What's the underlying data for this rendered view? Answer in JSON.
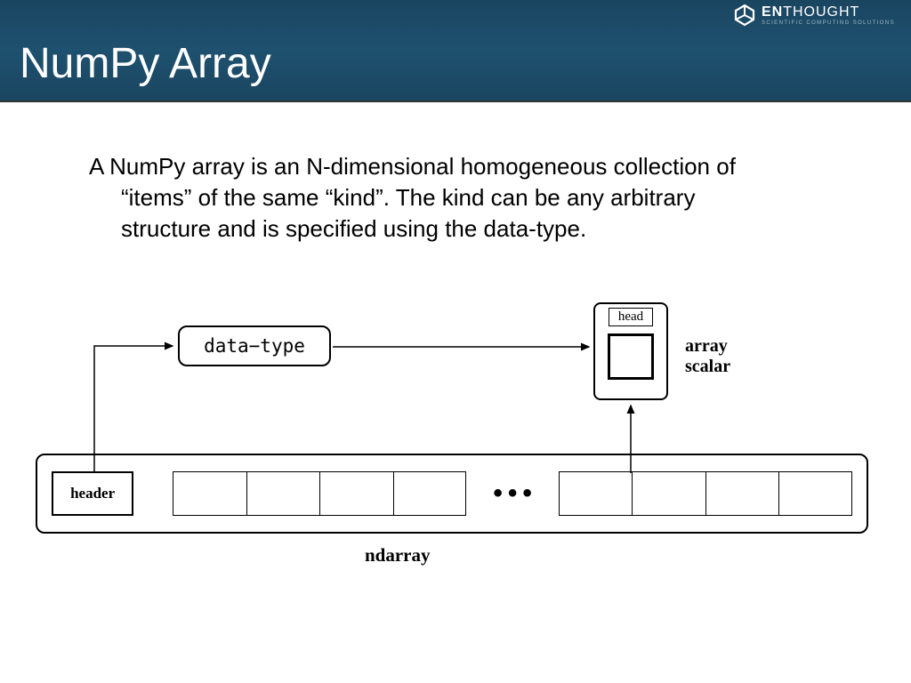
{
  "header": {
    "title": "NumPy Array",
    "logo": {
      "brand_prefix": "EN",
      "brand_suffix": "THOUGHT",
      "tagline": "SCIENTIFIC COMPUTING SOLUTIONS"
    }
  },
  "body_paragraph": "A NumPy array is an N-dimensional homogeneous collection of “items” of the same “kind”.  The kind can be any arbitrary structure and is specified using the data-type.",
  "diagram": {
    "data_type_label": "data−type",
    "scalar_head_label": "head",
    "scalar_side_label": "array\nscalar",
    "ndarray_header_cell": "header",
    "dots": "•••",
    "ndarray_label": "ndarray"
  }
}
